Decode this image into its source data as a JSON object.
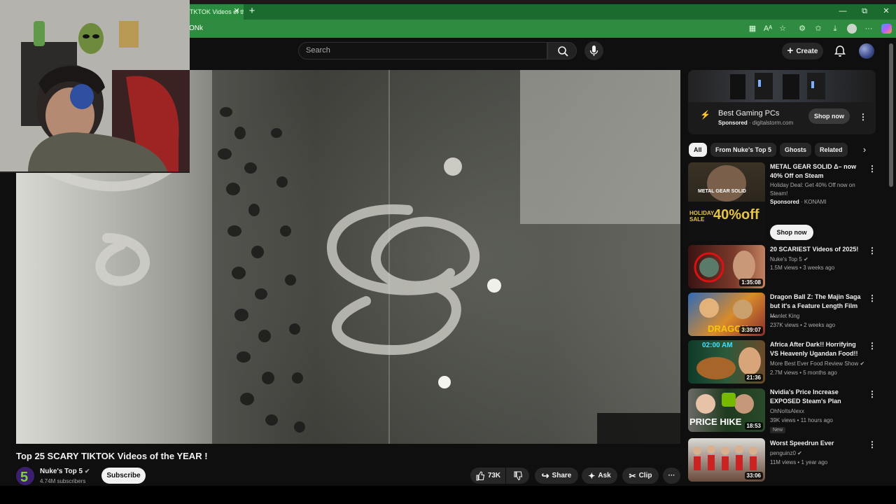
{
  "browser": {
    "tab_title": "TKTOK Videos of th",
    "tab_close": "✕",
    "new_tab": "+",
    "url": "ONk",
    "window": {
      "minimize": "—",
      "restore": "⧉",
      "close": "✕"
    }
  },
  "header": {
    "search_placeholder": "Search",
    "create_label": "Create"
  },
  "video": {
    "title": "Top 25 SCARY TIKTOK Videos of the YEAR !",
    "channel": "Nuke's Top 5",
    "subscribers": "4.74M subscribers",
    "subscribe_label": "Subscribe",
    "likes": "73K",
    "share_label": "Share",
    "ask_label": "Ask",
    "clip_label": "Clip"
  },
  "sidebar": {
    "ad": {
      "title": "Best Gaming PCs",
      "sponsored": "Sponsored",
      "domain": "· digitalstorm.com",
      "shop_label": "Shop now"
    },
    "chips": [
      "All",
      "From Nuke's Top 5",
      "Ghosts",
      "Related"
    ],
    "promo": {
      "title": "METAL GEAR SOLID Δ– now 40% Off on Steam",
      "desc": "Holiday Deal: Get 40% Off now on Steam!",
      "sponsored": "Sponsored",
      "advertiser": "· KONAMI",
      "shop_label": "Shop now",
      "thumb_title": "METAL GEAR SOLID",
      "thumb_sale": "HOLIDAY SALE",
      "thumb_pct": "40%off"
    },
    "videos": [
      {
        "title": "20 SCARIEST Videos of 2025!",
        "channel": "Nuke's Top 5",
        "meta": "1.5M views • 3 weeks ago",
        "duration": "1:35:08"
      },
      {
        "title": "Dragon Ball Z: The Majin Saga but it's a Feature Length Film ...",
        "channel": "Manlet King",
        "meta": "237K views • 2 weeks ago",
        "duration": "3:39:07"
      },
      {
        "title": "Africa After Dark!! Horrifying VS Heavenly Ugandan Food!!",
        "channel": "More Best Ever Food Review Show",
        "meta": "2.7M views • 5 months ago",
        "duration": "21:36",
        "thumb_clock": "02:00 AM"
      },
      {
        "title": "Nvidia's Price Increase EXPOSED Steam's Plan",
        "channel": "OhNoItsAlexx",
        "meta": "39K views • 11 hours ago",
        "duration": "18:53",
        "badge": "New",
        "thumb_text": "PRICE HIKE"
      },
      {
        "title": "Worst Speedrun Ever",
        "channel": "penguinz0",
        "meta": "11M views • 1 year ago",
        "duration": "33:06"
      }
    ]
  },
  "colors": {
    "browser_green": "#1c6b2e",
    "yt_bg": "#0f0f0f",
    "chip_bg": "#272727"
  }
}
